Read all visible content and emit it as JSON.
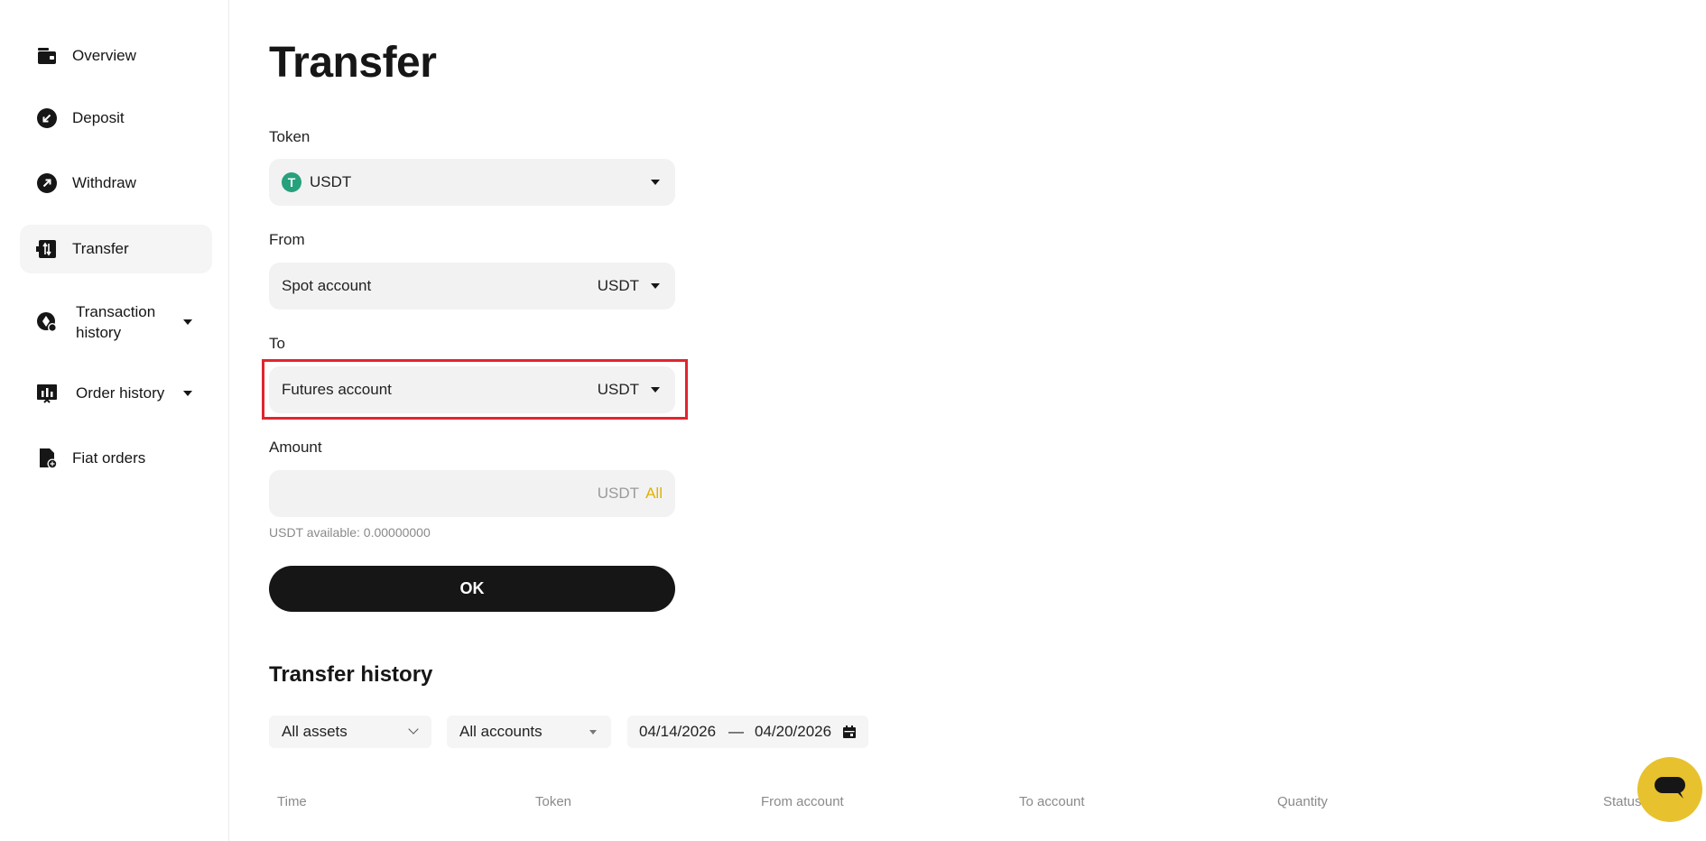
{
  "sidebar": {
    "items": [
      {
        "label": "Overview",
        "icon": "wallet-icon"
      },
      {
        "label": "Deposit",
        "icon": "deposit-arrow-icon"
      },
      {
        "label": "Withdraw",
        "icon": "withdraw-arrow-icon"
      },
      {
        "label": "Transfer",
        "icon": "transfer-icon",
        "active": true
      },
      {
        "label": "Transaction history",
        "icon": "transaction-history-icon",
        "expandable": true
      },
      {
        "label": "Order history",
        "icon": "order-history-icon",
        "expandable": true
      },
      {
        "label": "Fiat orders",
        "icon": "fiat-orders-icon"
      }
    ]
  },
  "main": {
    "title": "Transfer",
    "token": {
      "label": "Token",
      "value": "USDT",
      "icon_glyph": "T"
    },
    "from": {
      "label": "From",
      "value": "Spot account",
      "unit": "USDT"
    },
    "to": {
      "label": "To",
      "value": "Futures account",
      "unit": "USDT"
    },
    "amount": {
      "label": "Amount",
      "value": "",
      "placeholder": "",
      "unit": "USDT",
      "all_label": "All"
    },
    "available": "USDT available: 0.00000000",
    "ok_label": "OK"
  },
  "history": {
    "title": "Transfer history",
    "filters": {
      "assets": "All assets",
      "accounts": "All accounts",
      "date_start": "04/14/2026",
      "date_separator": "—",
      "date_end": "04/20/2026"
    },
    "columns": [
      "Time",
      "Token",
      "From account",
      "To account",
      "Quantity",
      "Status"
    ]
  },
  "colors": {
    "accent": "#e8c12f",
    "highlight": "#e0262f",
    "token": "#26a17b",
    "button": "#161616"
  }
}
